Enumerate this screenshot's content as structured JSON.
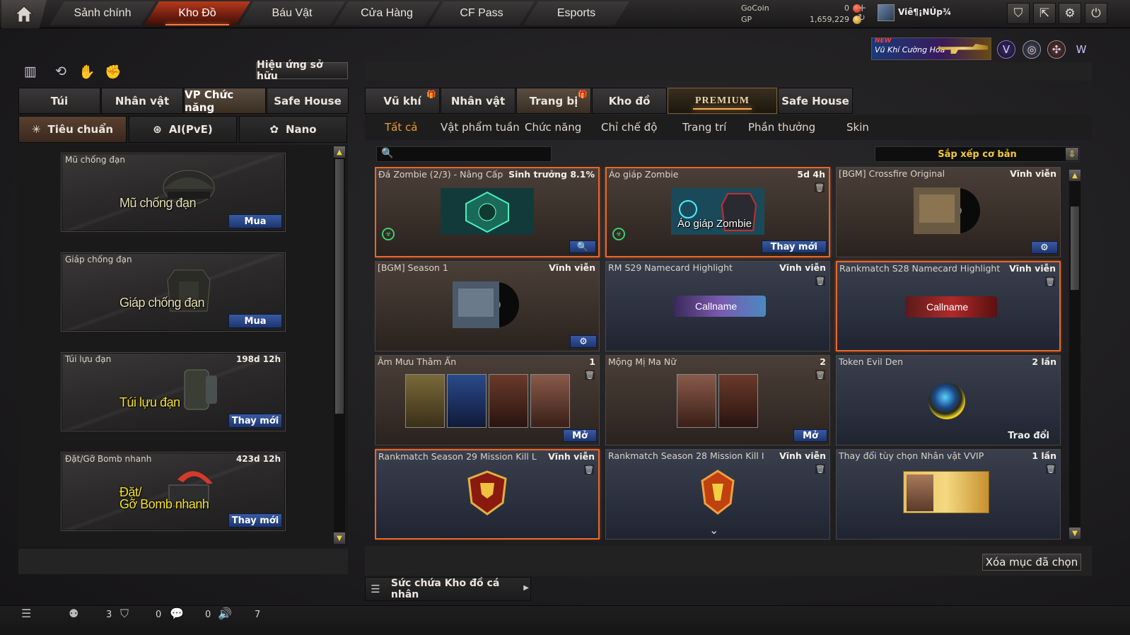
{
  "topnav": {
    "tabs": [
      "Sảnh chính",
      "Kho Đồ",
      "Báu Vật",
      "Cửa Hàng",
      "CF Pass",
      "Esports"
    ],
    "active_index": 1
  },
  "currency": {
    "gocoin_label": "GoCoin",
    "gocoin_value": "0",
    "gp_label": "GP",
    "gp_value": "1,659,229",
    "plus": "+",
    "refresh": "↻"
  },
  "user": {
    "name": "Viê¶¡NÚp¾"
  },
  "promo": {
    "new_label": "NEW",
    "text": "Vũ Khí Cường Hóa"
  },
  "left": {
    "owned_effects": "Hiệu ứng sở hữu",
    "tabs": [
      "Túi",
      "Nhân vật",
      "VP Chức năng",
      "Safe House"
    ],
    "subtabs": [
      "Tiêu chuẩn",
      "AI(PvE)",
      "Nano"
    ],
    "items": [
      {
        "name": "Mũ chống đạn",
        "duration": "",
        "caption": "Mũ chống đạn",
        "action": "Mua"
      },
      {
        "name": "Giáp chống đạn",
        "duration": "",
        "caption": "Giáp chống đạn",
        "action": "Mua"
      },
      {
        "name": "Túi lựu đạn",
        "duration": "198d 12h",
        "caption": "Túi lựu đạn",
        "action": "Thay mới"
      },
      {
        "name": "Đặt/Gỡ Bomb nhanh",
        "duration": "423d 12h",
        "caption_line1": "Đặt/",
        "caption_line2": "Gỡ Bomb nhanh",
        "action": "Thay mới"
      }
    ]
  },
  "right": {
    "tabs": [
      "Vũ khí",
      "Nhân vật",
      "Trang bị",
      "Kho đồ",
      "PREMIUM",
      "Safe House"
    ],
    "subnav": [
      "Tất cả",
      "Vật phẩm tuần",
      "Chức năng",
      "Chỉ chế độ",
      "Trang trí",
      "Phần thưởng",
      "Skin"
    ],
    "search_placeholder": "",
    "sort_label": "Sắp xếp cơ bản",
    "items": [
      {
        "title": "Đá Zombie (2/3) - Nâng Cấp",
        "info": "Sinh trưởng 8.1%",
        "action": "🔍"
      },
      {
        "title": "Áo giáp Zombie",
        "info": "5d 4h",
        "caption": "Áo giáp Zombie",
        "action": "Thay mới"
      },
      {
        "title": "[BGM] Crossfire Original",
        "info": "Vĩnh viễn",
        "action": "⚙"
      },
      {
        "title": "[BGM] Season 1",
        "info": "Vĩnh viễn",
        "action": "⚙"
      },
      {
        "title": "RM S29 Namecard Highlight",
        "info": "Vĩnh viễn",
        "caption": "Callname"
      },
      {
        "title": "Rankmatch S28 Namecard Highlight",
        "info": "Vĩnh viễn",
        "caption": "Callname"
      },
      {
        "title": "Âm Mưu Thâm Ẩn",
        "info": "1",
        "action": "Mở"
      },
      {
        "title": "Mộng Mị Ma Nữ",
        "info": "2",
        "action": "Mở"
      },
      {
        "title": "Token Evil Den",
        "info": "2 lần",
        "action": "Trao đổi"
      },
      {
        "title": "Rankmatch Season 29 Mission Kill L",
        "info": "Vĩnh viễn"
      },
      {
        "title": "Rankmatch Season 28 Mission Kill I",
        "info": "Vĩnh viễn"
      },
      {
        "title": "Thay đổi tùy chọn Nhân vật VVIP",
        "info": "1 lần"
      }
    ],
    "delete_selected": "Xóa mục đã chọn",
    "capacity": "Sức chứa Kho đồ cá nhân"
  },
  "status": {
    "a": "3",
    "b": "0",
    "c": "0",
    "d": "7"
  }
}
